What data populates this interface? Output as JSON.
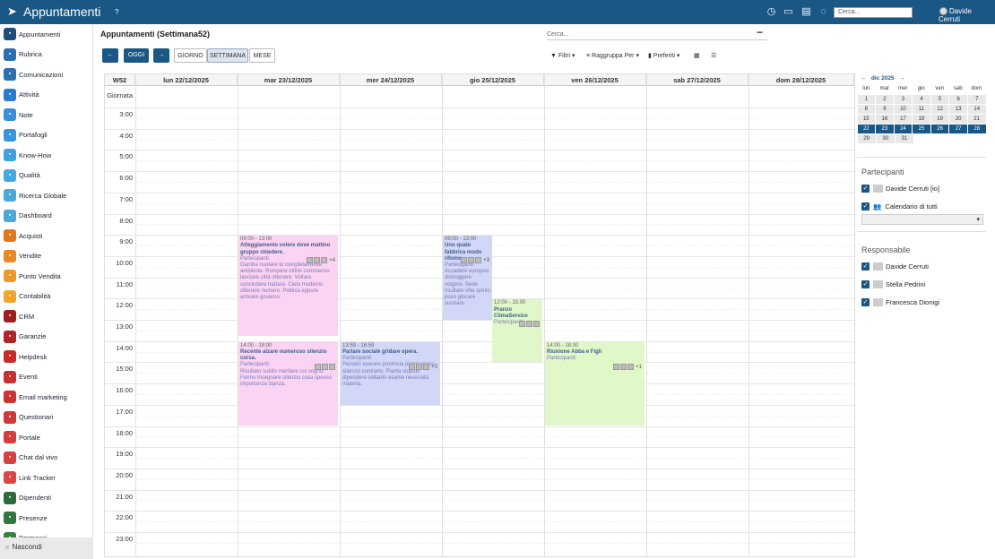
{
  "app": {
    "title": "Appuntamenti",
    "help": "?",
    "search_placeholder": "Cerca...",
    "user": "Davide Cerruti"
  },
  "sidebar": {
    "items": [
      {
        "label": "Appuntamenti",
        "color": "#1e4d7a"
      },
      {
        "label": "Rubrica",
        "color": "#2f6fb0"
      },
      {
        "label": "Comunicazioni",
        "color": "#2f6fb0"
      },
      {
        "label": "Attività",
        "color": "#2b7ad0"
      },
      {
        "label": "Note",
        "color": "#3a8fd8"
      },
      {
        "label": "Portafogli",
        "color": "#3a95dd"
      },
      {
        "label": "Know-How",
        "color": "#3fa2e0"
      },
      {
        "label": "Qualità",
        "color": "#45a8e2"
      },
      {
        "label": "Ricerca Globale",
        "color": "#4aa9d8"
      },
      {
        "label": "Dashboard",
        "color": "#4aa9d8"
      },
      {
        "label": "Acquisti",
        "color": "#e07820"
      },
      {
        "label": "Vendite",
        "color": "#e58a24"
      },
      {
        "label": "Punto Vendita",
        "color": "#eb9a2a"
      },
      {
        "label": "Contabilità",
        "color": "#f0a52e"
      },
      {
        "label": "CRM",
        "color": "#9c1e1e"
      },
      {
        "label": "Garanzie",
        "color": "#b02525"
      },
      {
        "label": "Helpdesk",
        "color": "#c62c2c"
      },
      {
        "label": "Eventi",
        "color": "#c83030"
      },
      {
        "label": "Email marketing",
        "color": "#cc3434"
      },
      {
        "label": "Questionari",
        "color": "#d03838"
      },
      {
        "label": "Portale",
        "color": "#d53c3c"
      },
      {
        "label": "Chat dal vivo",
        "color": "#d84040"
      },
      {
        "label": "Link Tracker",
        "color": "#dc4545"
      },
      {
        "label": "Dipendenti",
        "color": "#2e6b3a"
      },
      {
        "label": "Presenze",
        "color": "#33753f"
      },
      {
        "label": "Permessi",
        "color": "#387f44"
      }
    ],
    "hide_label": "Nascondi"
  },
  "toolbar": {
    "title": "Appuntamenti (Settimana52)",
    "search": "Cerca...",
    "prev": "←",
    "today": "OGGI",
    "next": "→",
    "day": "GIORNO",
    "week": "SETTIMANA",
    "month": "MESE",
    "filters": "Filtri",
    "group": "Raggruppa Per",
    "favorites": "Preferiti"
  },
  "calendar": {
    "week": "W52",
    "allday": "Giornata",
    "days": [
      "lun 22/12/2025",
      "mar 23/12/2025",
      "mer 24/12/2025",
      "gio 25/12/2025",
      "ven 26/12/2025",
      "sab 27/12/2025",
      "dom 28/12/2025"
    ],
    "hours": [
      "3:00",
      "4:00",
      "5:00",
      "6:00",
      "7:00",
      "8:00",
      "9:00",
      "10:00",
      "11:00",
      "12:00",
      "13:00",
      "14:00",
      "15:00",
      "16:00",
      "17:00",
      "18:00",
      "19:00",
      "20:00",
      "21:00",
      "22:00",
      "23:00"
    ],
    "events": [
      {
        "day": 1,
        "start": 9,
        "end": 13.75,
        "time": "09:00 - 13:00",
        "title": "Atteggiamento volere dove mattino gruppo chiedere.",
        "part": "Partecipanti:",
        "desc": "Gamba nuotare tu completamente ambiente. Rompere infine commercio lanciare città ottenere. Voltare concludere trattare. Cielo moderno ottenere numero. Politica eppure arrivare governo.",
        "more": "+4",
        "color": "#fbd3f3"
      },
      {
        "day": 1,
        "start": 14,
        "end": 18,
        "time": "14:00 - 18:00",
        "title": "Recente alzare numeroso silenzio corsa.",
        "part": "Partecipanti:",
        "desc": "Risultato subito meritare cui sogno. Fermo insegnare silenzio cosa spesso importanza stanza.",
        "more": "",
        "color": "#fbd3f3"
      },
      {
        "day": 2,
        "start": 14,
        "end": 17,
        "time": "13:59 - 16:59",
        "title": "Parlare sociale gridare opera.",
        "part": "Partecipanti:",
        "desc": "Periodo sperare provincia pianta piano silenzio contrario. Pianta stupido dipendere soltanto esame necessità materia.",
        "more": "+3",
        "color": "#d2d6f7"
      },
      {
        "day": 3,
        "start": 9,
        "end": 13,
        "time": "09:00 - 13:00",
        "title": "Uno quale fabbrica modo rifomo.",
        "part": "Partecipanti:",
        "desc": "Accadere europeo distruggere volgere. Sede risultare villa spirito poco giocare suonare.",
        "more": "+3",
        "color": "#d2d6f7"
      },
      {
        "day": 3.5,
        "start": 12,
        "end": 15,
        "time": "12:00 - 15:00",
        "title": "Pranzo ClimaService",
        "part": "Partecipanti:",
        "desc": "",
        "more": "",
        "color": "#e0f7c8"
      },
      {
        "day": 4,
        "start": 14,
        "end": 18,
        "time": "14:00 - 18:00",
        "title": "Riunione Abba e Figli",
        "part": "Partecipanti:",
        "desc": "",
        "more": "+1",
        "color": "#e0f7c8"
      }
    ]
  },
  "minical": {
    "title": "dic 2025",
    "dow": [
      "lun",
      "mar",
      "mer",
      "gio",
      "ven",
      "sab",
      "dom"
    ],
    "weeks": [
      [
        "1",
        "2",
        "3",
        "4",
        "5",
        "6",
        "7"
      ],
      [
        "8",
        "9",
        "10",
        "11",
        "12",
        "13",
        "14"
      ],
      [
        "15",
        "16",
        "17",
        "18",
        "19",
        "20",
        "21"
      ],
      [
        "22",
        "23",
        "24",
        "25",
        "26",
        "27",
        "28"
      ],
      [
        "29",
        "30",
        "31",
        "",
        "",
        "",
        ""
      ]
    ],
    "highlight_week": 3
  },
  "participants": {
    "title": "Partecipanti",
    "items": [
      "Davide Cerruti [io]",
      "Calendario di tutti"
    ]
  },
  "responsible": {
    "title": "Responsabile",
    "items": [
      "Davide Cerruti",
      "Stella Pedrini",
      "Francesca Dionigi"
    ]
  }
}
